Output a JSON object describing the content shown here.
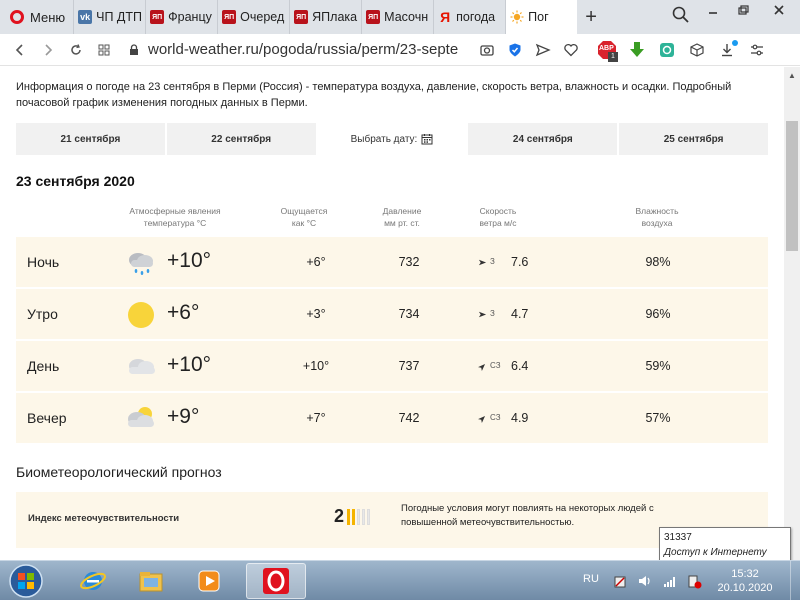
{
  "browser": {
    "menu_label": "Меню",
    "tabs": [
      {
        "label": "ЧП ДТП",
        "icon": "vk-icon",
        "color": "#4a76a8"
      },
      {
        "label": "Францу",
        "icon": "yaplakal-icon",
        "color": "#b8121b"
      },
      {
        "label": "Очеред",
        "icon": "yaplakal-icon",
        "color": "#b8121b"
      },
      {
        "label": "ЯПлака",
        "icon": "yaplakal-icon",
        "color": "#b8121b"
      },
      {
        "label": "Масочн",
        "icon": "yaplakal-icon",
        "color": "#b8121b"
      },
      {
        "label": "погода",
        "icon": "yandex-icon",
        "color": "#e61400"
      },
      {
        "label": "Пог",
        "icon": "sun-icon",
        "color": "#f5a623",
        "active": true
      }
    ],
    "url": "world-weather.ru/pogoda/russia/perm/23-septe",
    "adblock_badge": "1",
    "adblock_label": "ABP"
  },
  "page": {
    "intro": "Информация о погоде на 23 сентября в Перми (Россия) - температура воздуха, давление, скорость ветра, влажность и осадки. Подробный почасовой график изменения погодных данных в Перми.",
    "dates": [
      "21 сентября",
      "22 сентября",
      "Выбрать дату:",
      "24 сентября",
      "25 сентября"
    ],
    "day_title": "23 сентября 2020",
    "headers": {
      "weather_line1": "Атмосферные явления",
      "weather_line2": "температура °С",
      "feels_line1": "Ощущается",
      "feels_line2": "как °С",
      "pressure_line1": "Давление",
      "pressure_line2": "мм рт. ст.",
      "wind_line1": "Скорость",
      "wind_line2": "ветра м/с",
      "humidity_line1": "Влажность",
      "humidity_line2": "воздуха"
    },
    "rows": [
      {
        "period": "Ночь",
        "icon": "cloud-rain-icon",
        "temp": "+10°",
        "feels": "+6°",
        "pressure": "732",
        "wind_dir": "З",
        "wind_speed": "7.6",
        "humidity": "98%"
      },
      {
        "period": "Утро",
        "icon": "sun-icon",
        "temp": "+6°",
        "feels": "+3°",
        "pressure": "734",
        "wind_dir": "З",
        "wind_speed": "4.7",
        "humidity": "96%"
      },
      {
        "period": "День",
        "icon": "cloud-icon",
        "temp": "+10°",
        "feels": "+10°",
        "pressure": "737",
        "wind_dir": "СЗ",
        "wind_speed": "6.4",
        "humidity": "59%"
      },
      {
        "period": "Вечер",
        "icon": "cloud-sun-icon",
        "temp": "+9°",
        "feels": "+7°",
        "pressure": "742",
        "wind_dir": "СЗ",
        "wind_speed": "4.9",
        "humidity": "57%"
      }
    ],
    "bio": {
      "title": "Биометеорологический прогноз",
      "label": "Индекс метеочувствительности",
      "value": "2",
      "level_of_5": 2,
      "text": "Погодные условия могут повлиять на некоторых людей с повышенной метеочувствительностью."
    }
  },
  "tooltip": {
    "line1": "31337",
    "line2": "Доступ к Интернету"
  },
  "taskbar": {
    "lang": "RU",
    "time": "15:32",
    "date": "20.10.2020"
  },
  "colors": {
    "row_bg": "#fdf7e9",
    "accent": "#f5b400",
    "opera_red": "#e0121f"
  }
}
